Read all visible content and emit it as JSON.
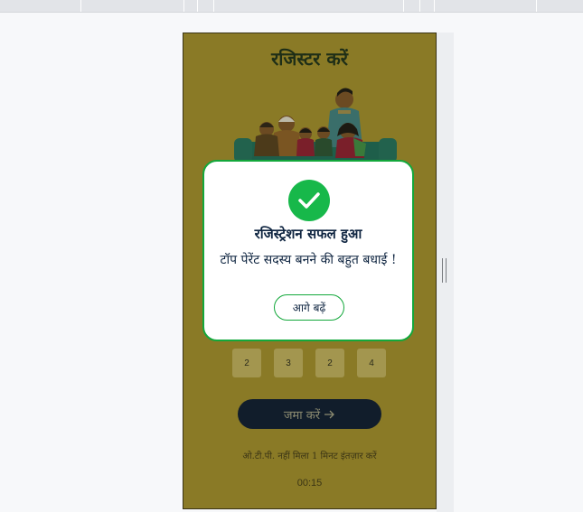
{
  "screen": {
    "title": "रजिस्टर करें",
    "otp_digits": [
      "2",
      "3",
      "2",
      "4"
    ],
    "submit_label": "जमा करें",
    "submit_icon": "arrow-right-icon",
    "otp_not_received": "ओ.टी.पी. नहीं मिला 1 मिनट इंतज़ार करें",
    "timer": "00:15"
  },
  "modal": {
    "icon": "check-icon",
    "title": "रजिस्ट्रेशन सफल हुआ",
    "message": "टॉप पेरेंट सदस्य बनने की बहुत बधाई !",
    "next_label": "आगे बढ़ें"
  },
  "colors": {
    "overlay": "#8a7a26",
    "accent_green": "#13a83b",
    "navy": "#0e2440",
    "submit_bg": "#111d2b"
  }
}
